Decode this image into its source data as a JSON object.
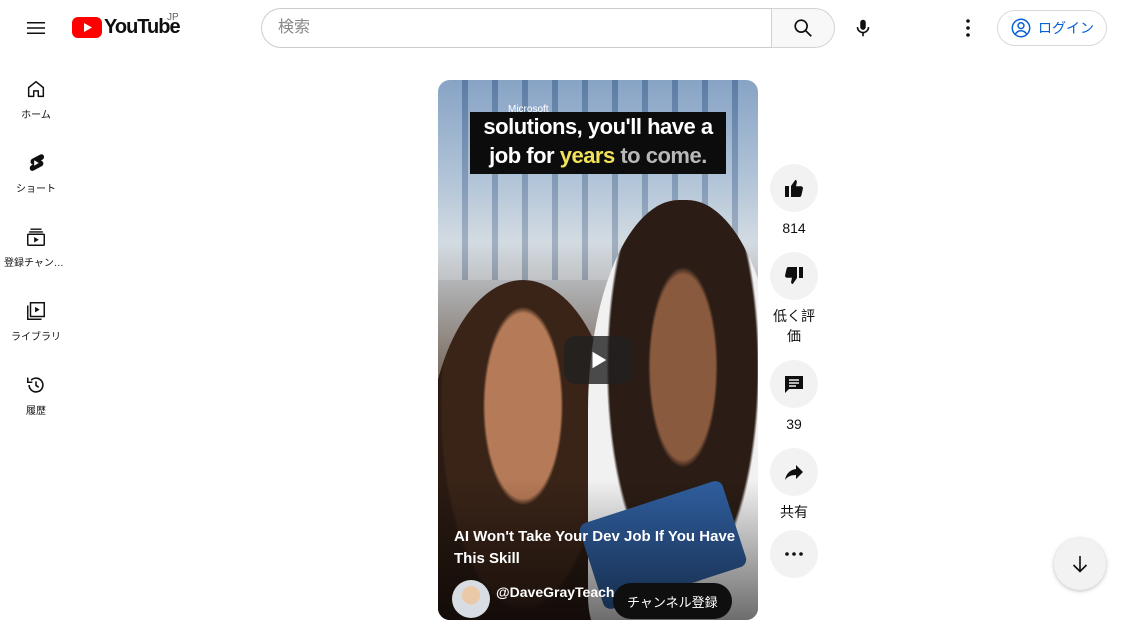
{
  "header": {
    "logo_text": "YouTube",
    "region": "JP",
    "search_placeholder": "検索",
    "login_label": "ログイン"
  },
  "sidebar": {
    "items": [
      {
        "label": "ホーム",
        "icon": "home-icon"
      },
      {
        "label": "ショート",
        "icon": "shorts-icon"
      },
      {
        "label": "登録チャンネル",
        "icon": "subscriptions-icon"
      },
      {
        "label": "ライブラリ",
        "icon": "library-icon"
      },
      {
        "label": "履歴",
        "icon": "history-icon"
      }
    ]
  },
  "video": {
    "caption_tag": "Microsoft",
    "caption_line1": "solutions, you'll have a",
    "caption_line2_a": "job for ",
    "caption_line2_b": "years",
    "caption_line2_c": " to come.",
    "title": "AI Won't Take Your Dev Job If You Have This Skill",
    "channel": "@DaveGrayTeach",
    "subscribe_label": "チャンネル登録"
  },
  "actions": {
    "like_count": "814",
    "dislike_label": "低く評価",
    "comment_count": "39",
    "share_label": "共有"
  },
  "colors": {
    "brand_red": "#ff0000",
    "link_blue": "#065fd4"
  }
}
